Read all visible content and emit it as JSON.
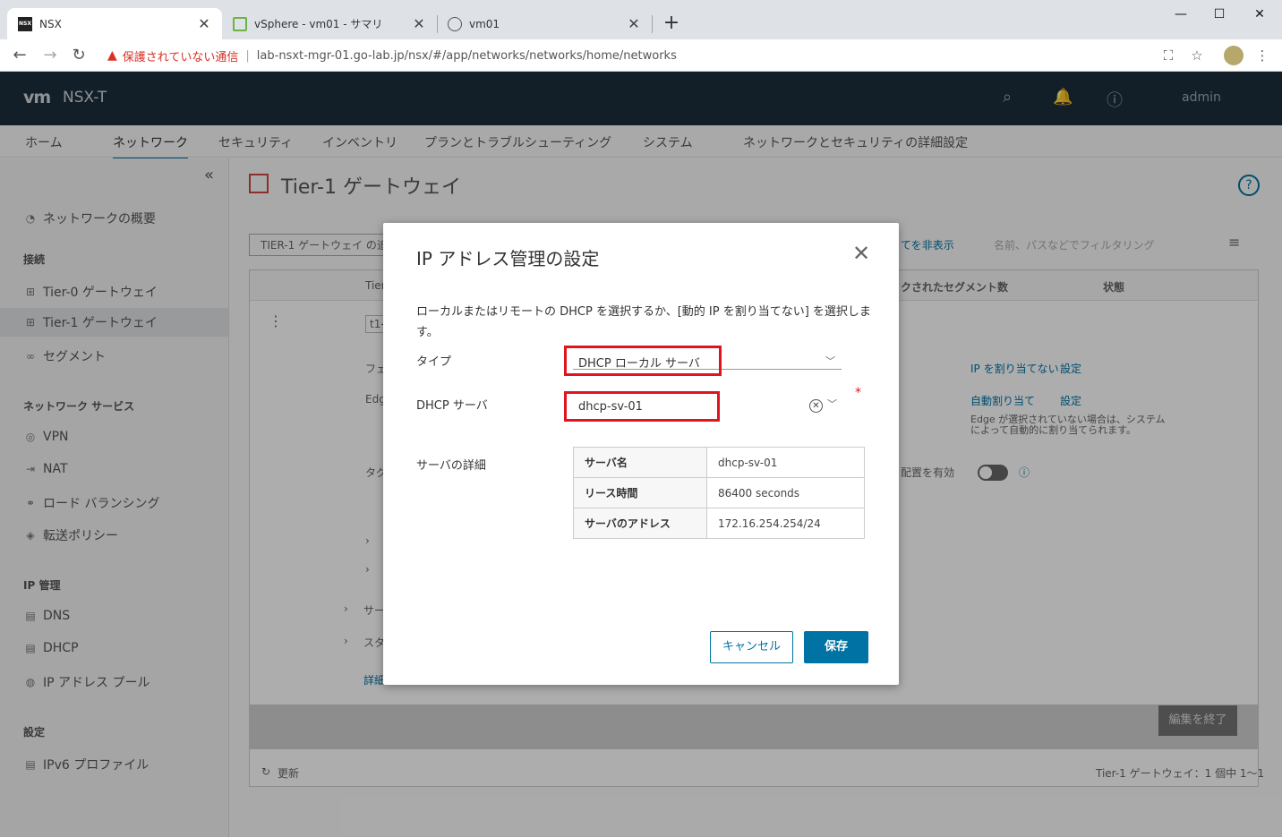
{
  "browser": {
    "tabs": [
      {
        "title": "NSX",
        "favicon": "nsx-favicon",
        "active": true
      },
      {
        "title": "vSphere - vm01 - サマリ",
        "favicon": "vsphere-favicon",
        "active": false
      },
      {
        "title": "vm01",
        "favicon": "globe-favicon",
        "active": false
      }
    ],
    "security_warning": "保護されていない通信",
    "url": "lab-nsxt-mgr-01.go-lab.jp/nsx/#/app/networks/networks/home/networks"
  },
  "app": {
    "logo": "vm",
    "product": "NSX-T",
    "user": "admin"
  },
  "topnav": {
    "items": [
      "ホーム",
      "ネットワーク",
      "セキュリティ",
      "インベントリ",
      "プランとトラブルシューティング",
      "システム",
      "ネットワークとセキュリティの詳細設定"
    ],
    "active": "ネットワーク"
  },
  "sidebar": {
    "overview": "ネットワークの概要",
    "sections": [
      {
        "heading": "接続",
        "items": [
          "Tier-0 ゲートウェイ",
          "Tier-1 ゲートウェイ",
          "セグメント"
        ]
      },
      {
        "heading": "ネットワーク サービス",
        "items": [
          "VPN",
          "NAT",
          "ロード バランシング",
          "転送ポリシー"
        ]
      },
      {
        "heading": "IP 管理",
        "items": [
          "DNS",
          "DHCP",
          "IP アドレス プール"
        ]
      },
      {
        "heading": "設定",
        "items": [
          "IPv6 プロファイル"
        ]
      }
    ],
    "selected": "Tier-1 ゲートウェイ"
  },
  "page": {
    "title": "Tier-1 ゲートウェイ",
    "filter_chip": "TIER-1 ゲートウェイ の追",
    "hide_link": "てを非表示",
    "filter_placeholder": "名前、パスなどでフィルタリング",
    "columns": {
      "tier": "Tier",
      "segments": "クされたセグメント数",
      "status": "状態"
    },
    "row_name": "t1-",
    "labels": {
      "fu": "フェ",
      "edge": "Edg",
      "tag": "タグ",
      "sa": "サー",
      "su": "スタ",
      "detail": "詳細"
    },
    "ip_link": "IP を割り当てない",
    "settings_link": "設定",
    "auto_assign": "自動割り当て",
    "settings2": "設定",
    "edge_note": "Edge が選択されていない場合は、システムによって自動的に割り当てられます。",
    "deploy_label": "配置を有効",
    "finish_button": "編集を終了",
    "refresh": "更新",
    "footer_count": "Tier-1 ゲートウェイ：1 個中 1～1"
  },
  "modal": {
    "title": "IP アドレス管理の設定",
    "description": "ローカルまたはリモートの DHCP を選択するか、[動的 IP を割り当てない] を選択します。",
    "type_label": "タイプ",
    "type_value": "DHCP ローカル サーバ",
    "server_label": "DHCP サーバ",
    "server_value": "dhcp-sv-01",
    "details_label": "サーバの詳細",
    "details": [
      {
        "key": "サーバ名",
        "value": "dhcp-sv-01"
      },
      {
        "key": "リース時間",
        "value": "86400 seconds"
      },
      {
        "key": "サーバのアドレス",
        "value": "172.16.254.254/24"
      }
    ],
    "cancel": "キャンセル",
    "save": "保存"
  },
  "colors": {
    "accent": "#0072a3",
    "highlight": "#e0141e",
    "header_bg": "#1d2f3c"
  }
}
